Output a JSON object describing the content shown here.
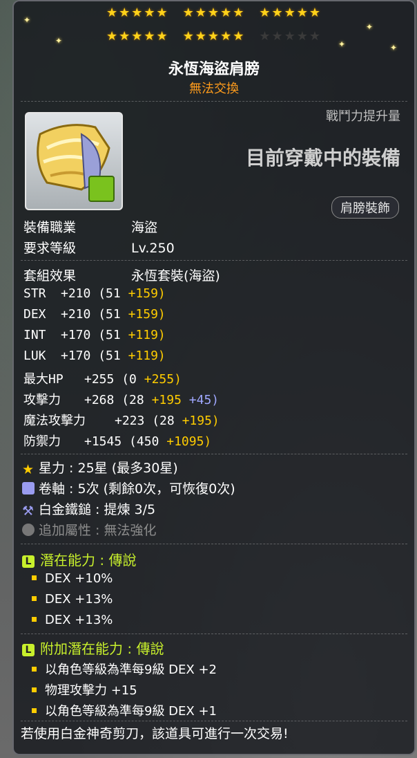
{
  "stars": {
    "row1_filled": 15,
    "row2_filled": 10,
    "row2_empty": 5
  },
  "item": {
    "name": "永恆海盜肩膀",
    "trade_status": "無法交換",
    "power_label": "戰鬥力提升量",
    "equipped_status": "目前穿戴中的裝備",
    "slot_type": "肩膀裝飾"
  },
  "requirements": {
    "job_label": "裝備職業",
    "job_value": "海盜",
    "level_label": "要求等級",
    "level_value": "Lv.250"
  },
  "set_effect": {
    "label": "套組效果",
    "value": "永恆套裝(海盜)"
  },
  "stats": [
    {
      "name": "STR",
      "total": "+210",
      "base": "(51",
      "bonus": "+159)",
      "extra": ""
    },
    {
      "name": "DEX",
      "total": "+210",
      "base": "(51",
      "bonus": "+159)",
      "extra": ""
    },
    {
      "name": "INT",
      "total": "+170",
      "base": "(51",
      "bonus": "+119)",
      "extra": ""
    },
    {
      "name": "LUK",
      "total": "+170",
      "base": "(51",
      "bonus": "+119)",
      "extra": ""
    },
    {
      "name": "最大HP",
      "total": "+255",
      "base": "(0",
      "bonus": "+255)",
      "extra": ""
    },
    {
      "name": "攻擊力",
      "total": "+268",
      "base": "(28",
      "bonus": "+195",
      "extra": "+45)"
    },
    {
      "name": "魔法攻擊力",
      "total": "+223",
      "base": "(28",
      "bonus": "+195)",
      "extra": ""
    },
    {
      "name": "防禦力",
      "total": "+1545",
      "base": "(450",
      "bonus": "+1095)",
      "extra": ""
    }
  ],
  "enhancements": {
    "starforce": "星力 : 25星 (最多30星)",
    "scroll": "卷軸 : 5次 (剩餘0次，可恢復0次)",
    "platinum": "白金鐵鎚 : 提煉 3/5",
    "additional": "追加屬性 : 無法強化"
  },
  "potential": {
    "title": "潛在能力 : 傳說",
    "lines": [
      "DEX +10%",
      "DEX +13%",
      "DEX +13%"
    ]
  },
  "bonus_potential": {
    "title": "附加潛在能力 : 傳說",
    "lines": [
      "以角色等級為準每9級 DEX +2",
      "物理攻擊力 +15",
      "以角色等級為準每9級 DEX +1"
    ]
  },
  "footer": "若使用白金神奇剪刀，該道具可進行一次交易!",
  "colors": {
    "gold": "#ffcc00",
    "orange": "#ff9c1c",
    "potential": "#c8f02c",
    "blue_bonus": "#a0a8ff"
  }
}
